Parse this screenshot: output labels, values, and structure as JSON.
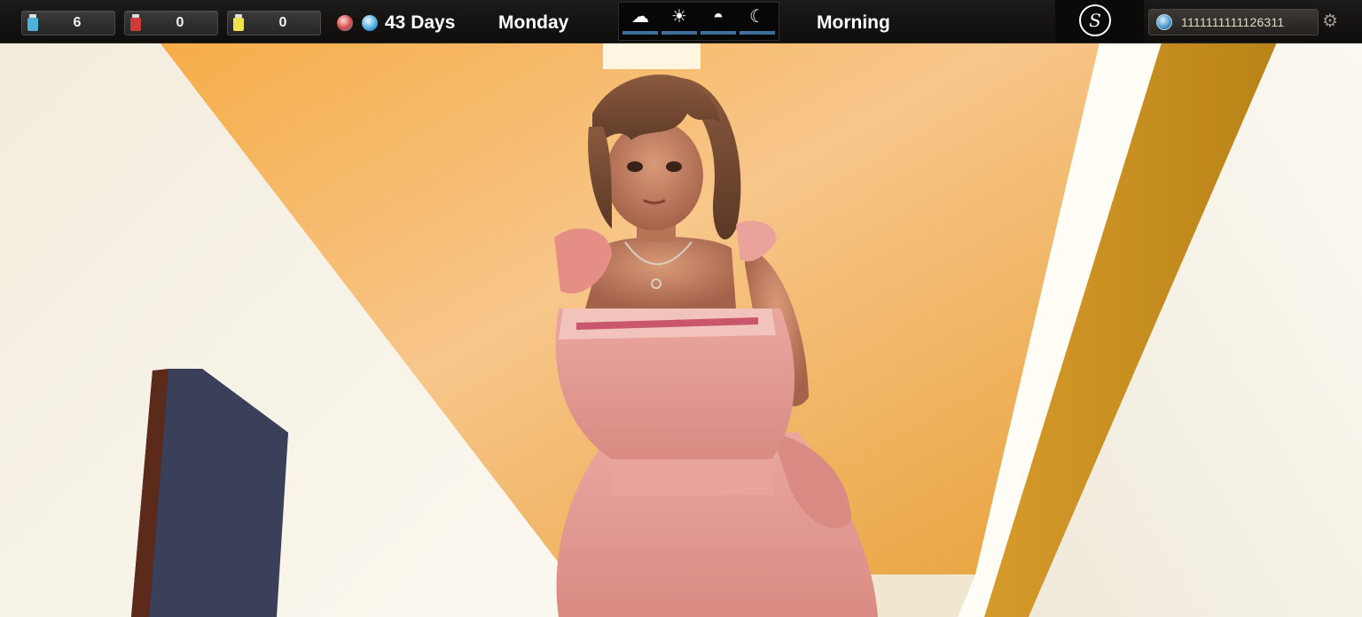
{
  "resources": [
    {
      "icon": "blue-potion-icon",
      "value": "6",
      "color": "#4fb3d9"
    },
    {
      "icon": "red-potion-icon",
      "value": "0",
      "color": "#d23a3a"
    },
    {
      "icon": "yellow-potion-icon",
      "value": "0",
      "color": "#f0e24a"
    }
  ],
  "status": {
    "days": "43 Days",
    "weekday": "Monday",
    "time_of_day": "Morning"
  },
  "day_phases": [
    {
      "icon": "sunrise-icon",
      "glyph": "☁"
    },
    {
      "icon": "sun-icon",
      "glyph": "☀"
    },
    {
      "icon": "sunset-icon",
      "glyph": "◓"
    },
    {
      "icon": "moon-icon",
      "glyph": "☾"
    }
  ],
  "money": {
    "icon": "coin-icon",
    "value": "1111111111126311"
  },
  "settings": {
    "icon": "gear-icon",
    "glyph": "⚙"
  },
  "logo": {
    "icon": "game-logo-icon",
    "glyph": "S"
  },
  "colors": {
    "hud_bg": "#141210",
    "phase_bar": "#3c6f9a",
    "ceiling": "#f1a64a",
    "wall": "#f4efe4",
    "dress": "#e49a92"
  }
}
